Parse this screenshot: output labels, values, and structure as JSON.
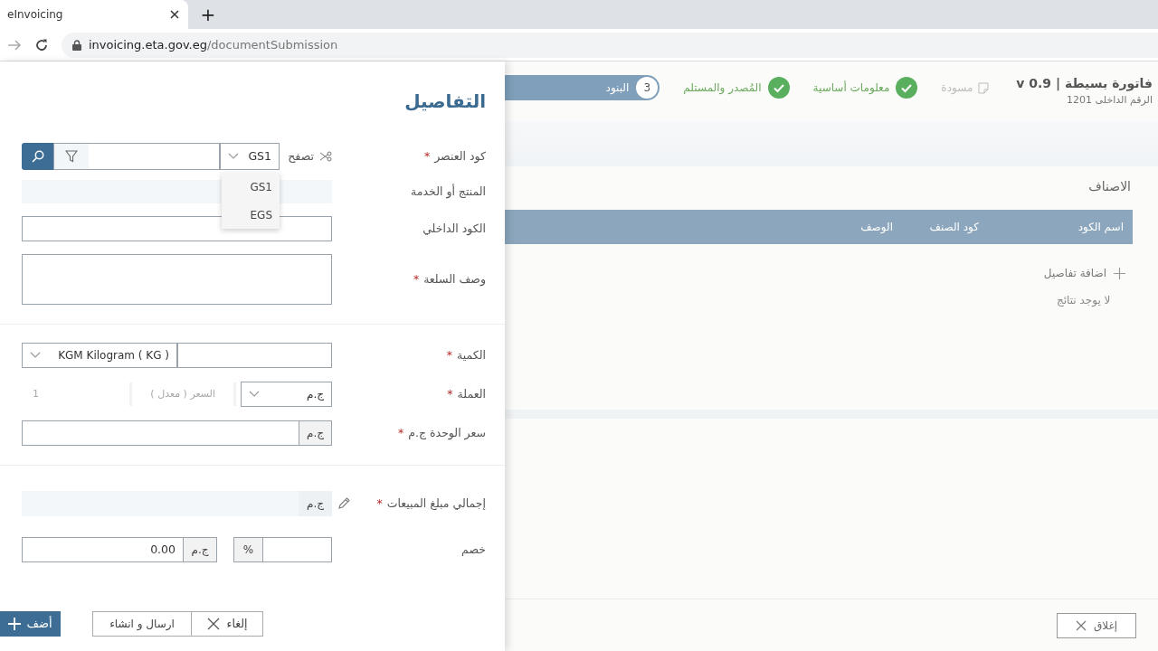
{
  "browser": {
    "tab_title": "eInvoicing",
    "new_tab": "+",
    "url_host": "invoicing.eta.gov.eg",
    "url_path": "/documentSubmission"
  },
  "panel": {
    "title": "التفاصيل",
    "rows": [
      {
        "kind": "item-code",
        "label": "كود العنصر",
        "asterisk": "*",
        "browse": "تصفح",
        "select_value": "GS1",
        "options": [
          "GS1",
          "EGS"
        ],
        "expanded": true
      },
      {
        "kind": "readonly",
        "label": "المنتج أو الخدمة"
      },
      {
        "kind": "input",
        "label": "الكود الداخلي"
      },
      {
        "kind": "textarea",
        "label": "وصف السلعة",
        "asterisk": "*"
      },
      {
        "kind": "divider"
      },
      {
        "kind": "quantity",
        "label": "الكمية",
        "asterisk": "*",
        "unit": "KGM Kilogram ( KG )"
      },
      {
        "kind": "currency",
        "label": "العملة",
        "asterisk": "*",
        "value": "ج.م",
        "rate_placeholder": "السعر ( معدل )",
        "rate_value": "1"
      },
      {
        "kind": "price",
        "label": "سعر الوحدة ج.م",
        "asterisk": "*",
        "addon": "ج.م"
      },
      {
        "kind": "divider"
      },
      {
        "kind": "total",
        "label": "إجمالي مبلغ المبيعات",
        "asterisk": "*",
        "addon": "ج.م"
      },
      {
        "kind": "discount",
        "label": "خصم",
        "percent_addon": "%",
        "amount_addon": "ج.م",
        "amount": "0.00"
      }
    ],
    "buttons": [
      {
        "kind": "cancel",
        "label": "إلغاء"
      },
      {
        "kind": "secondary",
        "label": "ارسال و انشاء"
      },
      {
        "kind": "primary",
        "label": "أضف"
      }
    ]
  },
  "invoice": {
    "title": "فاتورة بسيطة | v 0.9",
    "subtitle": "الرقم الداخلى 1201",
    "steps": [
      {
        "kind": "draft",
        "label": "مسودة"
      },
      {
        "kind": "done",
        "label": "معلومات أساسية"
      },
      {
        "kind": "done",
        "label": "المُصدر والمستلم"
      },
      {
        "kind": "current",
        "number": "3",
        "label": "البنود"
      }
    ],
    "section_title": "الاصناف",
    "columns": [
      "اسم الكود",
      "كود الصنف",
      "الوصف"
    ],
    "add_details": "اضافة تفاصيل",
    "empty": "لا يوجد نتائج",
    "close": "إغلاق"
  }
}
